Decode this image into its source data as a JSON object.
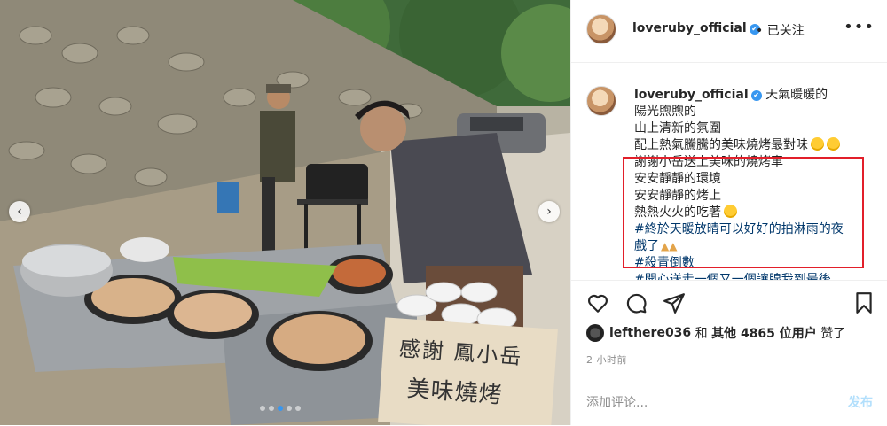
{
  "post": {
    "username": "loveruby_official",
    "verified_glyph": "✔",
    "follow_status": "• 已关注",
    "more_icon": "•••"
  },
  "caption": {
    "lines": [
      "天氣暖暖的",
      "陽光煦煦的",
      "山上清新的氛圍",
      "配上熱氣騰騰的美味燒烤最對味",
      "謝謝小岳送上美味的燒烤車",
      "安安靜靜的環境",
      "安安靜靜的烤上",
      "熱熱火火的吃著",
      "#終於天暖放晴可以好好的拍淋雨的夜",
      "戲了",
      "#殺青倒數",
      "#開心送走一個又一個讓腺我到最後"
    ]
  },
  "photo": {
    "sign_line1": "感謝 鳳小岳",
    "sign_line2": "美味燒烤",
    "prev_arrow": "‹",
    "next_arrow": "›",
    "carousel_total": 5,
    "carousel_active": 2
  },
  "actions": {
    "like": "heart-outline-icon",
    "comment": "comment-bubble-icon",
    "share": "paper-plane-icon",
    "save": "bookmark-icon"
  },
  "likes": {
    "user": "lefthere036",
    "connector": "和",
    "others": "其他 4865 位用户",
    "suffix": "赞了"
  },
  "timestamp": "2 小时前",
  "comment": {
    "placeholder": "添加评论...",
    "post_label": "发布"
  },
  "colors": {
    "link": "#00376b",
    "verified": "#3897f0",
    "highlight_box": "#e21f2a",
    "post_disabled": "#b2dffc"
  }
}
